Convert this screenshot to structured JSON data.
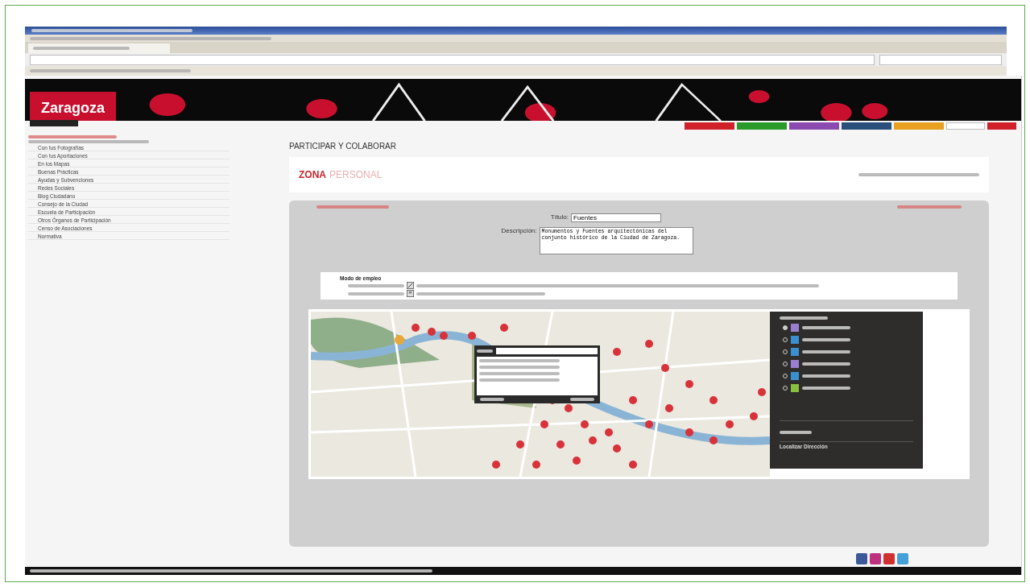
{
  "site": {
    "logo": "Zaragoza"
  },
  "nav_tabs": [
    {
      "color": "#d0202a"
    },
    {
      "color": "#2a9a2a"
    },
    {
      "color": "#8a4ab0"
    },
    {
      "color": "#2a4f7a"
    },
    {
      "color": "#e8a020"
    }
  ],
  "sidebar": {
    "items": [
      {
        "label": "Con tus Fotografías"
      },
      {
        "label": "Con tus Aportaciones"
      },
      {
        "label": "En los Mapas"
      },
      {
        "label": "Buenas Prácticas"
      },
      {
        "label": "Ayudas y Subvenciones"
      },
      {
        "label": "Redes Sociales"
      },
      {
        "label": "Blog Ciudadano"
      },
      {
        "label": "Consejo de la Ciudad"
      },
      {
        "label": "Escuela de Participación"
      },
      {
        "label": "Otros Órganos de Participación"
      },
      {
        "label": "Censo de Asociaciones"
      },
      {
        "label": "Normativa"
      }
    ]
  },
  "page": {
    "title": "PARTICIPAR Y COLABORAR",
    "zone_strong": "ZONA",
    "zone_light": "PERSONAL"
  },
  "form": {
    "title_label": "Título:",
    "title_value": "Fuentes",
    "description_label": "Descripción:",
    "description_value": "Monumentos y Fuentes arquitectónicas del conjunto histórico de la Ciudad de Zaragoza."
  },
  "instructions": {
    "heading": "Modo de empleo"
  },
  "map_panel": {
    "footer_link": "Localizar Dirección",
    "layers": [
      {
        "color": "#9a7fd0",
        "checked": true
      },
      {
        "color": "#3a8fd0",
        "checked": false
      },
      {
        "color": "#3a8fd0",
        "checked": false
      },
      {
        "color": "#9a7fd0",
        "checked": false
      },
      {
        "color": "#3a8fd0",
        "checked": false
      },
      {
        "color": "#8ac040",
        "checked": false
      }
    ]
  }
}
